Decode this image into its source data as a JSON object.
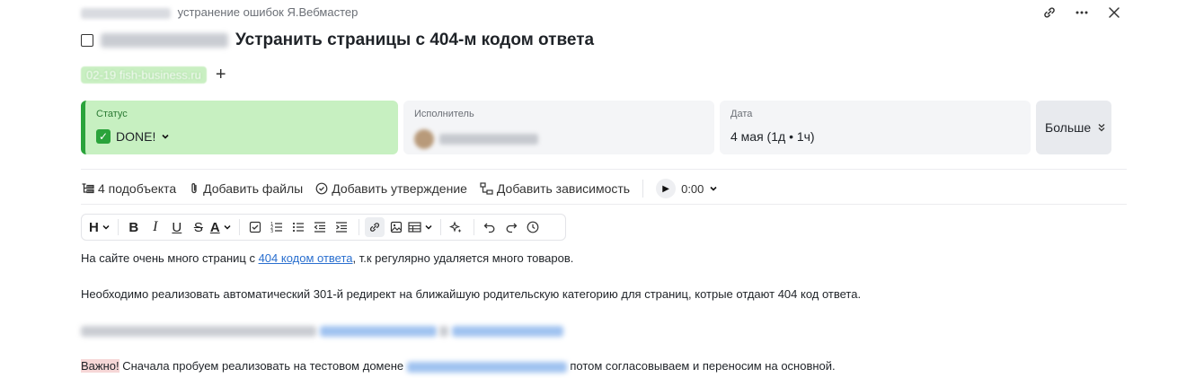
{
  "breadcrumb": {
    "label": "устранение ошибок Я.Вебмастер"
  },
  "task": {
    "title": "Устранить страницы с 404-м кодом ответа",
    "tag": "02-19 fish-business.ru"
  },
  "fields": {
    "status_label": "Статус",
    "status_value": "DONE!",
    "assignee_label": "Исполнитель",
    "date_label": "Дата",
    "date_value": "4 мая (1д • 1ч)",
    "more_label": "Больше"
  },
  "actions": {
    "subobjects": "4 подобъекта",
    "add_files": "Добавить файлы",
    "add_approval": "Добавить утверждение",
    "add_dependency": "Добавить зависимость",
    "timer": "0:00"
  },
  "toolbar": {
    "heading": "H",
    "bold": "B",
    "italic": "I",
    "underline": "U",
    "strike": "S",
    "color": "A"
  },
  "content": {
    "p1_before": "На сайте очень много страниц с ",
    "p1_link": "404 кодом ответа",
    "p1_after": ", т.к регулярно удаляется много товаров.",
    "p2": "Необходимо реализовать автоматический 301-й редирект на ближайшую родительскую категорию для страниц, котрые отдают 404 код ответа.",
    "p4_important": "Важно!",
    "p4_before": " Сначала пробуем реализовать на тестовом домене ",
    "p4_after": " потом согласовываем и переносим на основной."
  }
}
